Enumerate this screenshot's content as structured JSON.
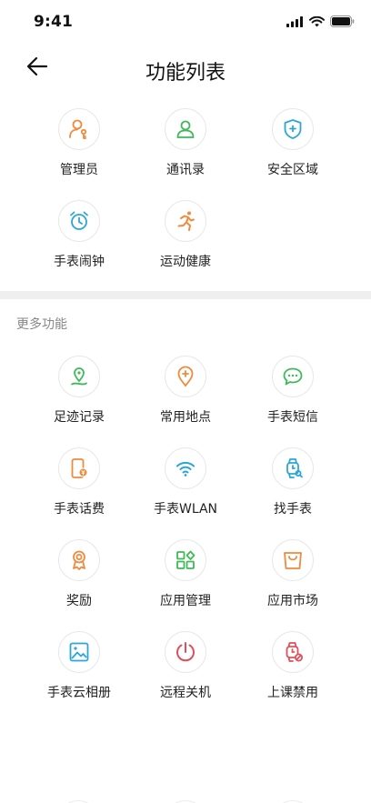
{
  "status_bar": {
    "time": "9:41"
  },
  "header": {
    "title": "功能列表"
  },
  "main_features": [
    {
      "label": "管理员",
      "icon": "admin-user-icon",
      "color": "#f08a3c"
    },
    {
      "label": "通讯录",
      "icon": "contacts-icon",
      "color": "#3fba5a"
    },
    {
      "label": "安全区域",
      "icon": "safe-zone-shield-icon",
      "color": "#2aa7d8"
    },
    {
      "label": "手表闹钟",
      "icon": "alarm-clock-icon",
      "color": "#2aa7d8"
    },
    {
      "label": "运动健康",
      "icon": "running-icon",
      "color": "#f08a3c"
    }
  ],
  "more_section": {
    "title": "更多功能"
  },
  "more_features": [
    {
      "label": "足迹记录",
      "icon": "footprint-location-icon",
      "color": "#3fba5a"
    },
    {
      "label": "常用地点",
      "icon": "favorite-place-icon",
      "color": "#f08a3c"
    },
    {
      "label": "手表短信",
      "icon": "message-bubble-icon",
      "color": "#3fba5a"
    },
    {
      "label": "手表话费",
      "icon": "phone-bill-icon",
      "color": "#f08a3c"
    },
    {
      "label": "手表WLAN",
      "icon": "wifi-icon",
      "color": "#2aa7d8"
    },
    {
      "label": "找手表",
      "icon": "find-watch-icon",
      "color": "#2aa7d8"
    },
    {
      "label": "奖励",
      "icon": "award-medal-icon",
      "color": "#f08a3c"
    },
    {
      "label": "应用管理",
      "icon": "app-management-icon",
      "color": "#3fba5a"
    },
    {
      "label": "应用市场",
      "icon": "app-market-bag-icon",
      "color": "#f08a3c"
    },
    {
      "label": "手表云相册",
      "icon": "cloud-album-icon",
      "color": "#2aa7d8"
    },
    {
      "label": "远程关机",
      "icon": "power-off-icon",
      "color": "#e0505a"
    },
    {
      "label": "上课禁用",
      "icon": "class-disable-watch-icon",
      "color": "#e0505a"
    }
  ]
}
